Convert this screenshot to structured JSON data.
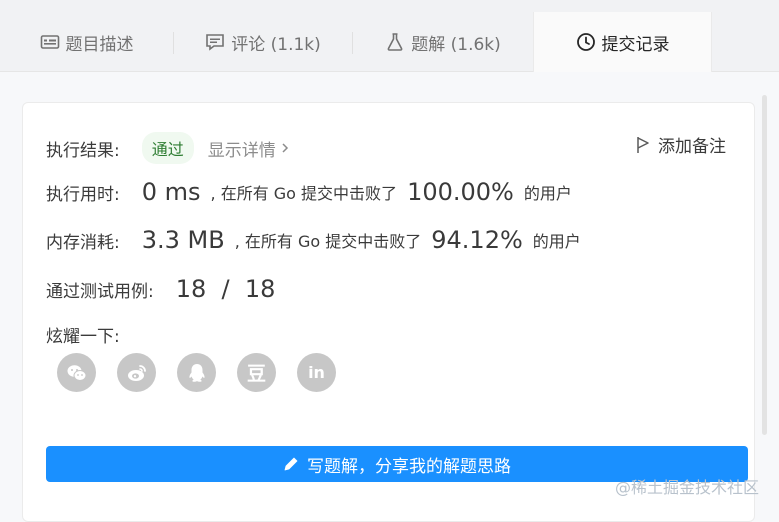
{
  "tabs": [
    {
      "label": "题目描述",
      "icon": "description-icon"
    },
    {
      "label": "评论 (1.1k)",
      "icon": "comment-icon"
    },
    {
      "label": "题解 (1.6k)",
      "icon": "flask-icon"
    },
    {
      "label": "提交记录",
      "icon": "clock-icon"
    }
  ],
  "result": {
    "label": "执行结果:",
    "status": "通过",
    "details": "显示详情",
    "add_note": "添加备注"
  },
  "runtime": {
    "label": "执行用时:",
    "value": "0 ms",
    "text": ", 在所有 Go 提交中击败了",
    "percent": "100.00%",
    "suffix": "的用户"
  },
  "memory": {
    "label": "内存消耗:",
    "value": "3.3 MB",
    "text": ", 在所有 Go 提交中击败了",
    "percent": "94.12%",
    "suffix": "的用户"
  },
  "tests": {
    "label": "通过测试用例:",
    "value": "18  /  18"
  },
  "share": {
    "label": "炫耀一下:",
    "buttons": [
      "wechat-icon",
      "weibo-icon",
      "qq-icon",
      "douban-icon",
      "linkedin-icon"
    ],
    "douban_glyph": "豆",
    "linkedin_glyph": "in"
  },
  "write_button": "写题解，分享我的解题思路",
  "watermark": "@稀土掘金技术社区",
  "colors": {
    "accent": "#1a90ff",
    "success": "#2e7d32",
    "success_bg": "#f0f9f0"
  }
}
